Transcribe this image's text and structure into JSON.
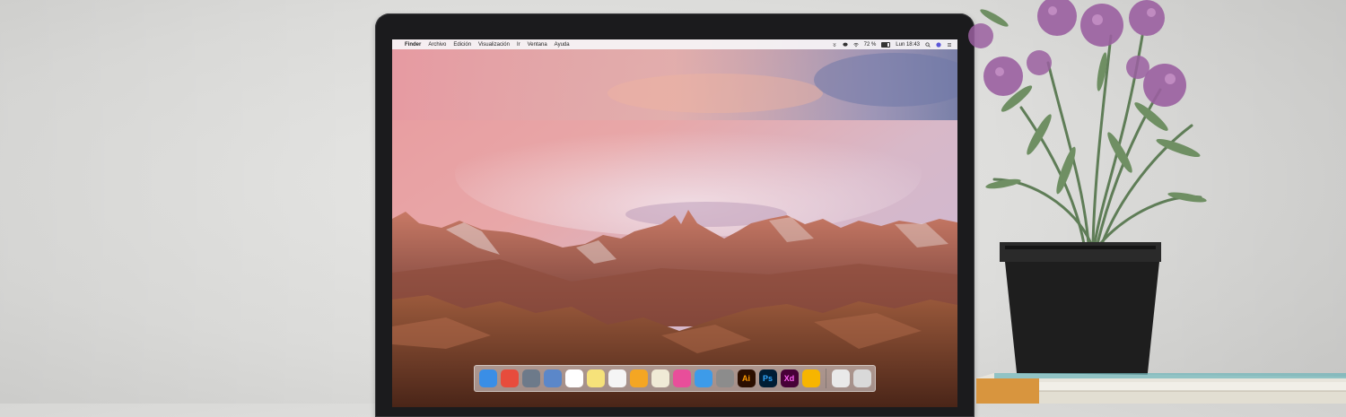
{
  "menubar": {
    "apple_glyph": "",
    "items": [
      "Finder",
      "Archivo",
      "Edición",
      "Visualización",
      "Ir",
      "Ventana",
      "Ayuda"
    ],
    "battery_percent": "72 %",
    "clock": "Lun 18:43"
  },
  "dock": {
    "apps": [
      {
        "icon": "finder-icon",
        "label": "",
        "color": "#3a8ee6"
      },
      {
        "icon": "chrome-icon",
        "label": "",
        "color": "#e74c3c"
      },
      {
        "icon": "launchpad-icon",
        "label": "",
        "color": "#6d7a8a"
      },
      {
        "icon": "preview-icon",
        "label": "",
        "color": "#5b87c9"
      },
      {
        "icon": "calendar-icon",
        "label": "",
        "color": "#ffffff"
      },
      {
        "icon": "notes-icon",
        "label": "",
        "color": "#f6e27a"
      },
      {
        "icon": "reminders-icon",
        "label": "",
        "color": "#f5f5f5"
      },
      {
        "icon": "photos-icon",
        "label": "",
        "color": "#f4a623"
      },
      {
        "icon": "textedit-icon",
        "label": "",
        "color": "#f0ead6"
      },
      {
        "icon": "itunes-icon",
        "label": "",
        "color": "#e84e9a"
      },
      {
        "icon": "app-store-icon",
        "label": "",
        "color": "#3d9be9"
      },
      {
        "icon": "system-preferences-icon",
        "label": "",
        "color": "#8c8c8c"
      },
      {
        "icon": "illustrator-icon",
        "label": "Ai",
        "color": "#2b0e00"
      },
      {
        "icon": "photoshop-icon",
        "label": "Ps",
        "color": "#001d34"
      },
      {
        "icon": "adobe-xd-icon",
        "label": "Xd",
        "color": "#470137"
      },
      {
        "icon": "sketch-icon",
        "label": "",
        "color": "#f7b500"
      },
      {
        "icon": "downloads-stack-icon",
        "label": "",
        "color": "#e9e9e9"
      },
      {
        "icon": "trash-icon",
        "label": "",
        "color": "#d9d9d9"
      }
    ]
  },
  "colors": {
    "wall": "#dddddb",
    "laptop_bezel": "#1b1b1d",
    "pot": "#1e1e1e",
    "flower": "#9a5fa0",
    "leaf": "#5f7d57"
  }
}
